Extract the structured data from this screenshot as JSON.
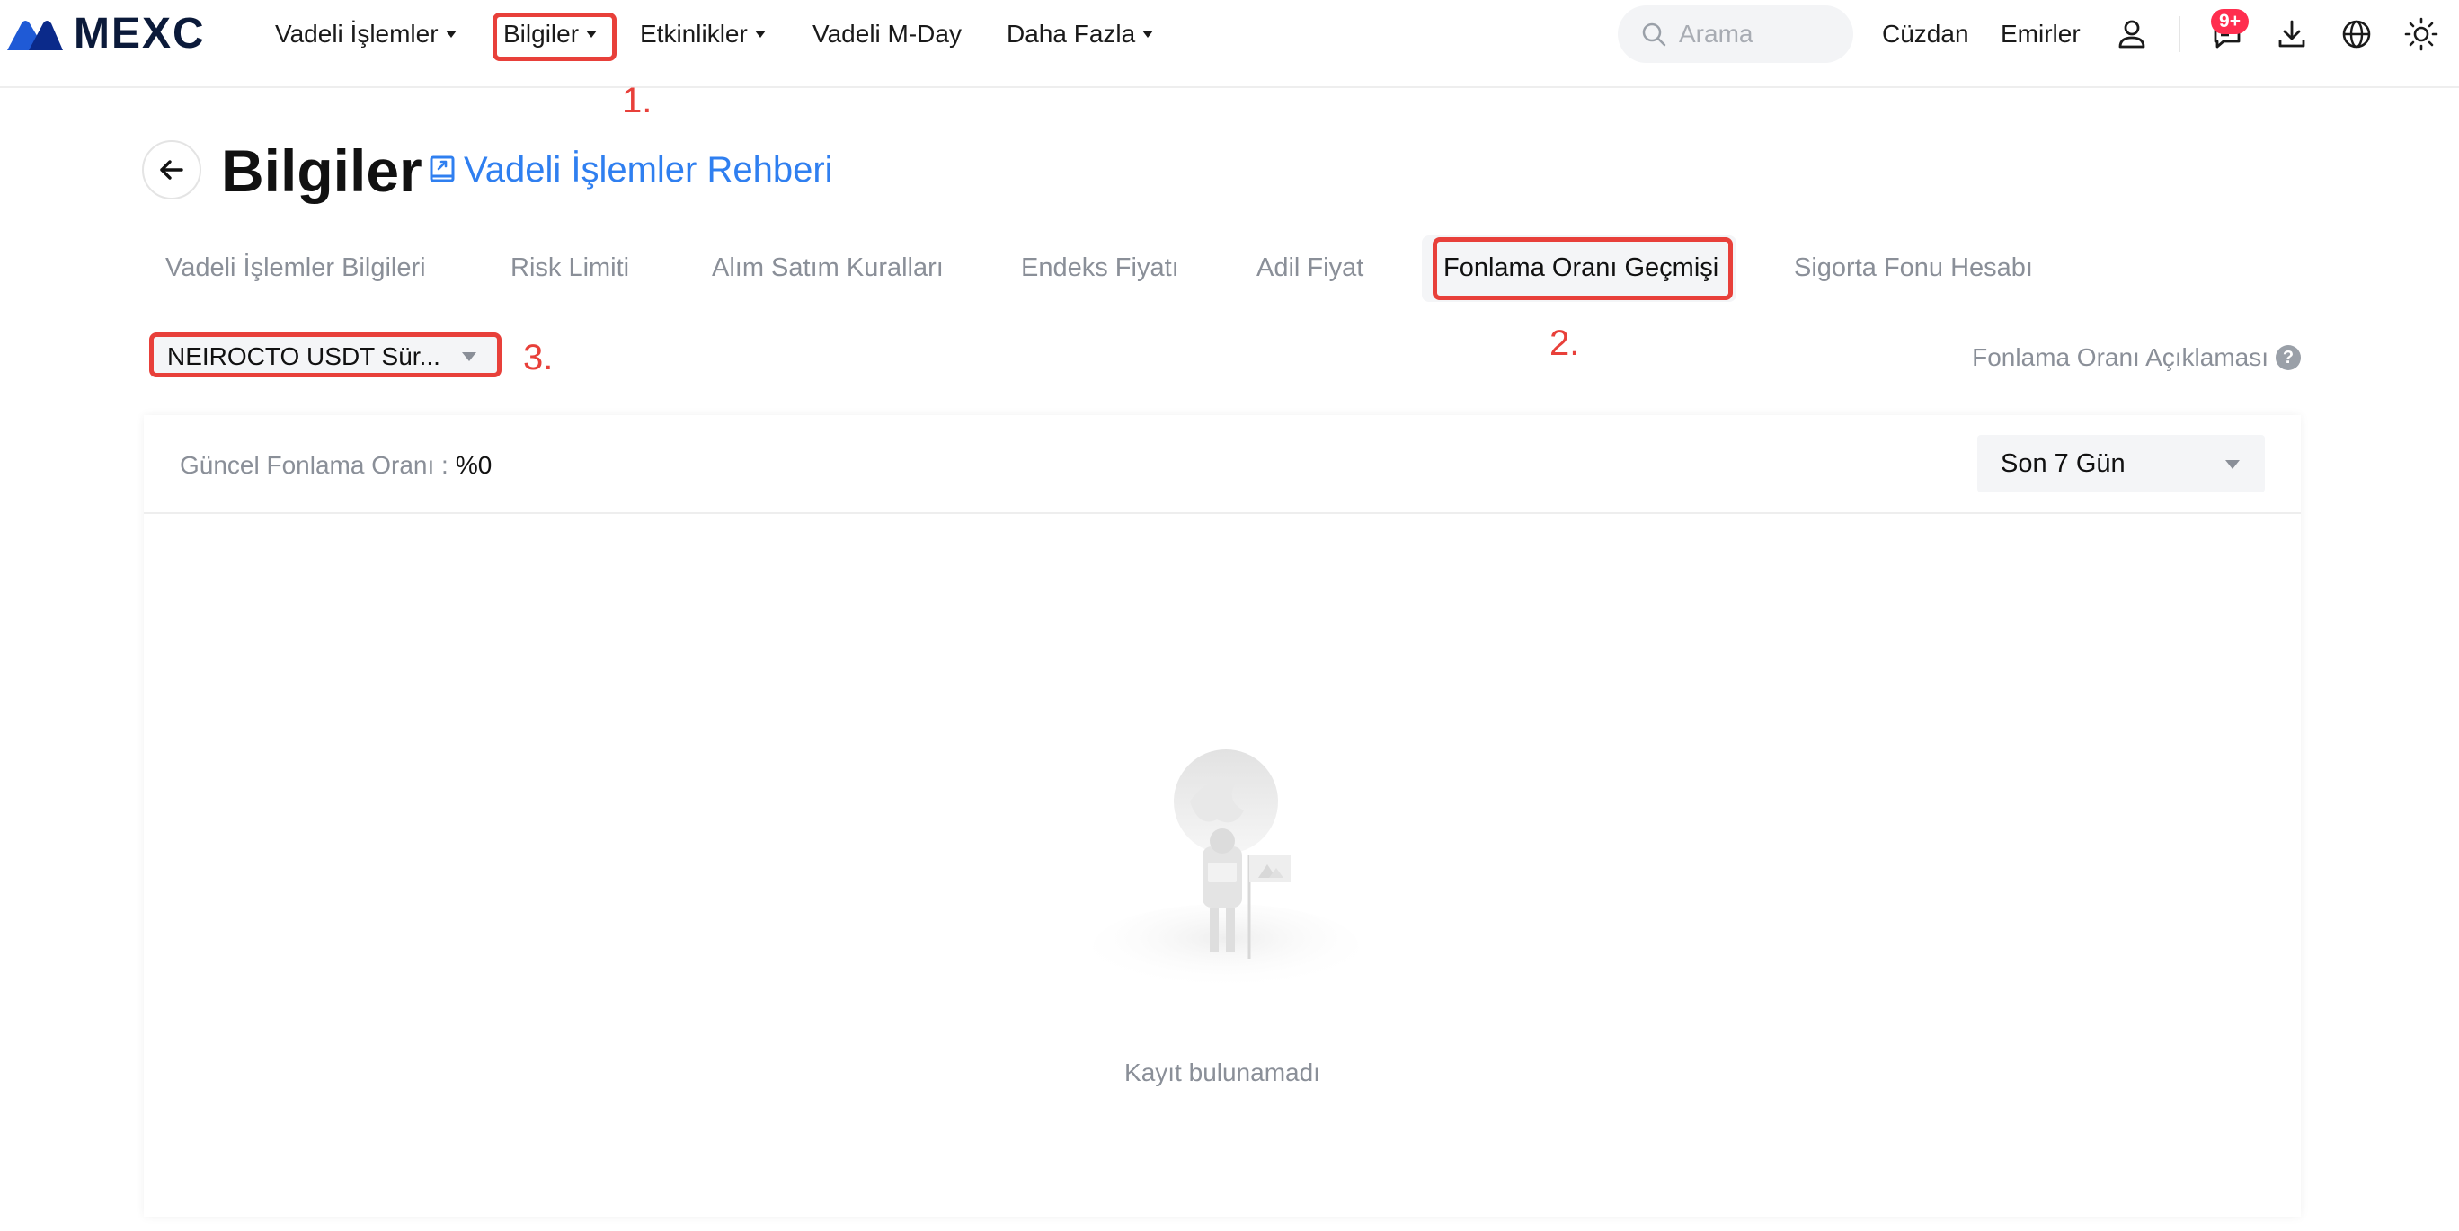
{
  "brand": {
    "name": "MEXC",
    "color": "#0b1a3a",
    "accent": "#2f7ff0"
  },
  "nav": {
    "items": [
      {
        "label": "Vadeli İşlemler",
        "has_dropdown": true
      },
      {
        "label": "Bilgiler",
        "has_dropdown": true
      },
      {
        "label": "Etkinlikler",
        "has_dropdown": true
      },
      {
        "label": "Vadeli M-Day",
        "has_dropdown": false
      },
      {
        "label": "Daha Fazla",
        "has_dropdown": true
      }
    ],
    "search_placeholder": "Arama",
    "wallet_label": "Cüzdan",
    "orders_label": "Emirler",
    "notification_badge": "9+",
    "icons": [
      "search-icon",
      "user-icon",
      "message-icon",
      "download-icon",
      "globe-icon",
      "sun-icon"
    ]
  },
  "annotations": {
    "step1": "1.",
    "step2": "2.",
    "step3": "3.",
    "color": "#e8403a"
  },
  "header": {
    "title": "Bilgiler",
    "guide_link": "Vadeli İşlemler Rehberi"
  },
  "tabs": [
    {
      "label": "Vadeli İşlemler Bilgileri",
      "active": false
    },
    {
      "label": "Risk Limiti",
      "active": false
    },
    {
      "label": "Alım Satım Kuralları",
      "active": false
    },
    {
      "label": "Endeks Fiyatı",
      "active": false
    },
    {
      "label": "Adil Fiyat",
      "active": false
    },
    {
      "label": "Fonlama Oranı Geçmişi",
      "active": true
    },
    {
      "label": "Sigorta Fonu Hesabı",
      "active": false
    }
  ],
  "contract_select": {
    "value": "NEIROCTO USDT Sür..."
  },
  "explain_link": "Fonlama Oranı Açıklaması",
  "panel": {
    "rate_label": "Güncel Fonlama Oranı :",
    "rate_value": "%0",
    "range_value": "Son 7 Gün",
    "empty_text": "Kayıt bulunamadı"
  }
}
